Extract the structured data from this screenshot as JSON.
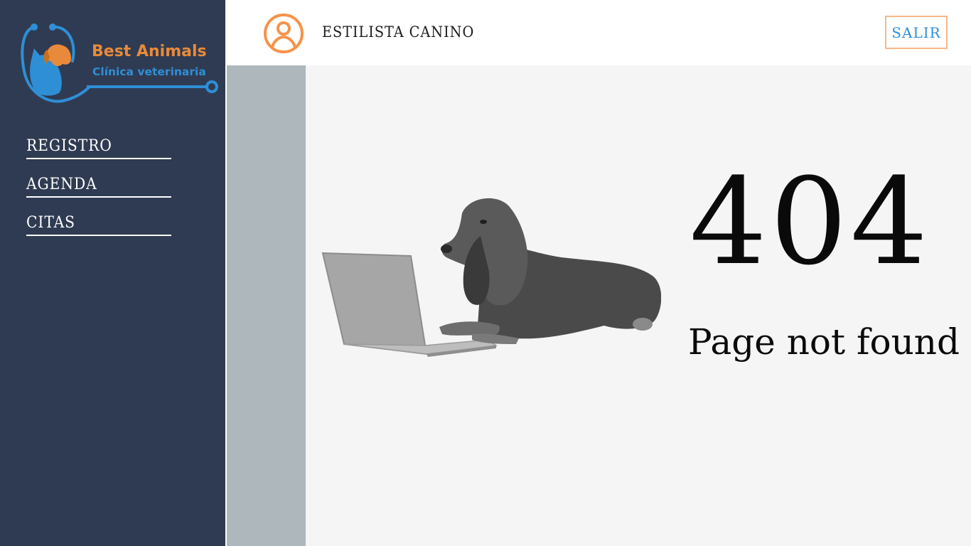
{
  "logo": {
    "title": "Best Animals",
    "subtitle": "Clínica veterinaria",
    "icon": "pet-stethoscope-logo"
  },
  "nav": {
    "items": [
      {
        "label": "REGISTRO"
      },
      {
        "label": "AGENDA"
      },
      {
        "label": "CITAS"
      }
    ]
  },
  "header": {
    "user_icon": "user-circle-icon",
    "role": "ESTILISTA CANINO",
    "logout_label": "SALIR"
  },
  "error": {
    "code": "404",
    "message": "Page not found",
    "illustration": "dog-with-laptop"
  },
  "colors": {
    "sidebar": "#2f3b52",
    "accent_orange": "#f6924a",
    "accent_blue": "#2e8fd6",
    "strip": "#adb7bc",
    "content_bg": "#f5f5f5"
  }
}
